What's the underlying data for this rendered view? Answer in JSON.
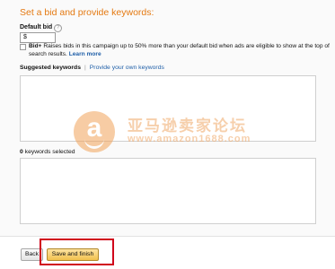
{
  "section": {
    "title": "Set a bid and provide keywords:"
  },
  "bid": {
    "label": "Default bid",
    "help_icon": "question-circle-icon",
    "value": "$"
  },
  "bid_plus": {
    "label": "Bid+",
    "description": "Raises bids in this campaign up to 50% more than your default bid when ads are eligible to show at the top of search results.",
    "learn_more": "Learn more",
    "checked": false
  },
  "keywords": {
    "tab_suggested": "Suggested keywords",
    "tab_separator": "|",
    "tab_own": "Provide your own keywords",
    "selected_count": "0",
    "selected_label": "keywords selected"
  },
  "watermark": {
    "logo_letter": "a",
    "title": "亚马逊卖家论坛",
    "url": "www.amazon1688.com"
  },
  "footer": {
    "back_label": "Back",
    "save_label": "Save and finish"
  },
  "colors": {
    "accent": "#e47911",
    "link": "#1f5fa8",
    "save_button": "#f2c14e",
    "highlight": "#d0021b"
  }
}
